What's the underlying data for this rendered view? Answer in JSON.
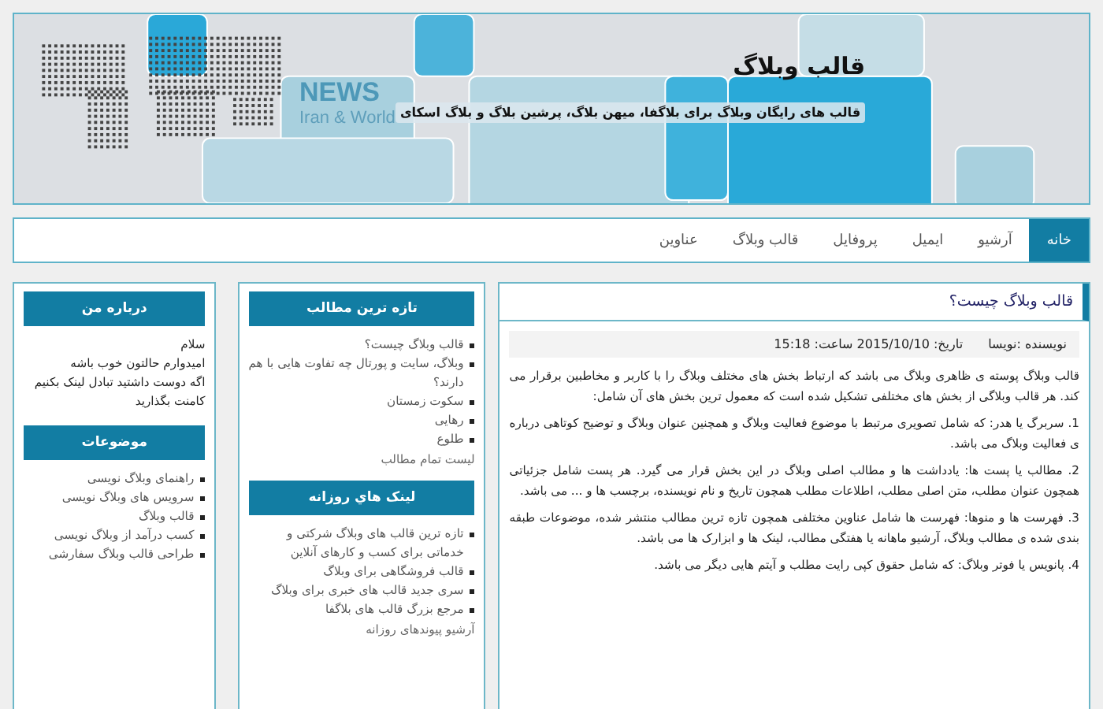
{
  "header": {
    "title": "قالب وبلاگ",
    "subtitle": "قالب های رایگان وبلاگ برای بلاگفا، میهن بلاگ، پرشین بلاگ و بلاگ اسکای",
    "news": "NEWS",
    "news_sub": "Iran & World"
  },
  "nav": [
    {
      "label": "خانه",
      "selected": true
    },
    {
      "label": "آرشیو",
      "selected": false
    },
    {
      "label": "ایمیل",
      "selected": false
    },
    {
      "label": "پروفایل",
      "selected": false
    },
    {
      "label": "قالب وبلاگ",
      "selected": false
    },
    {
      "label": "عناوین",
      "selected": false
    }
  ],
  "post": {
    "title": "قالب وبلاگ چیست؟",
    "author": "نویسنده :نویسا",
    "date": "تاریخ: 2015/10/10 ساعت: 15:18",
    "paragraphs": [
      "قالب وبلاگ پوسته ی ظاهری وبلاگ می باشد که ارتباط بخش های مختلف وبلاگ را با کاربر و مخاطبین برقرار می کند. هر قالب وبلاگی از بخش های مختلفی تشکیل شده است که معمول ترین بخش های آن شامل:",
      "1. سربرگ یا هدر: که شامل تصویری مرتبط با موضوع فعالیت وبلاگ و همچنین عنوان وبلاگ و توضیح کوتاهی درباره ی فعالیت وبلاگ می باشد.",
      "2. مطالب یا پست ها: یادداشت ها و مطالب اصلی وبلاگ در این بخش قرار می گیرد. هر پست شامل جزئیاتی همچون عنوان مطلب، متن اصلی مطلب، اطلاعات مطلب همچون تاریخ و نام نویسنده، برچسب ها و ... می باشد.",
      "3. فهرست ها و منوها: فهرست ها شامل عناوین مختلفی همچون تازه ترین مطالب منتشر شده، موضوعات طبقه بندی شده ی مطالب وبلاگ، آرشیو ماهانه یا هفتگی مطالب، لینک ها و ابزارک ها می باشد.",
      "4. پانویس یا فوتر وبلاگ: که شامل حقوق کپی رایت مطلب و آیتم هایی دیگر می باشد."
    ]
  },
  "middle": [
    {
      "title": "تازه ترین مطالب",
      "items": [
        "قالب وبلاگ چیست؟",
        "وبلاگ، سایت و پورتال چه تفاوت هایی با هم دارند؟",
        "سکوت زمستان",
        "رهایی",
        "طلوع"
      ],
      "footer": "لیست تمام مطالب"
    },
    {
      "title": "لینک هاي روزانه",
      "items": [
        "تازه ترین قالب های وبلاگ شرکتی و خدماتی برای کسب و کارهای آنلاین",
        "قالب فروشگاهی برای وبلاگ",
        "سری جدید قالب های خبری برای وبلاگ",
        "مرجع بزرگ قالب های بلاگفا"
      ],
      "footer": "آرشیو پیوندهای روزانه"
    }
  ],
  "about": {
    "title": "درباره من",
    "lines": [
      "سلام",
      "امیدوارم حالتون خوب باشه",
      "اگه دوست داشتید تبادل لینک بکنیم",
      "کامنت بگذارید"
    ]
  },
  "categories": {
    "title": "موضوعات",
    "items": [
      "راهنمای وبلاگ نویسی",
      "سرویس های وبلاگ نویسی",
      "قالب وبلاگ",
      "کسب درآمد از وبلاگ نویسی",
      "طراحی قالب وبلاگ سفارشی"
    ]
  }
}
